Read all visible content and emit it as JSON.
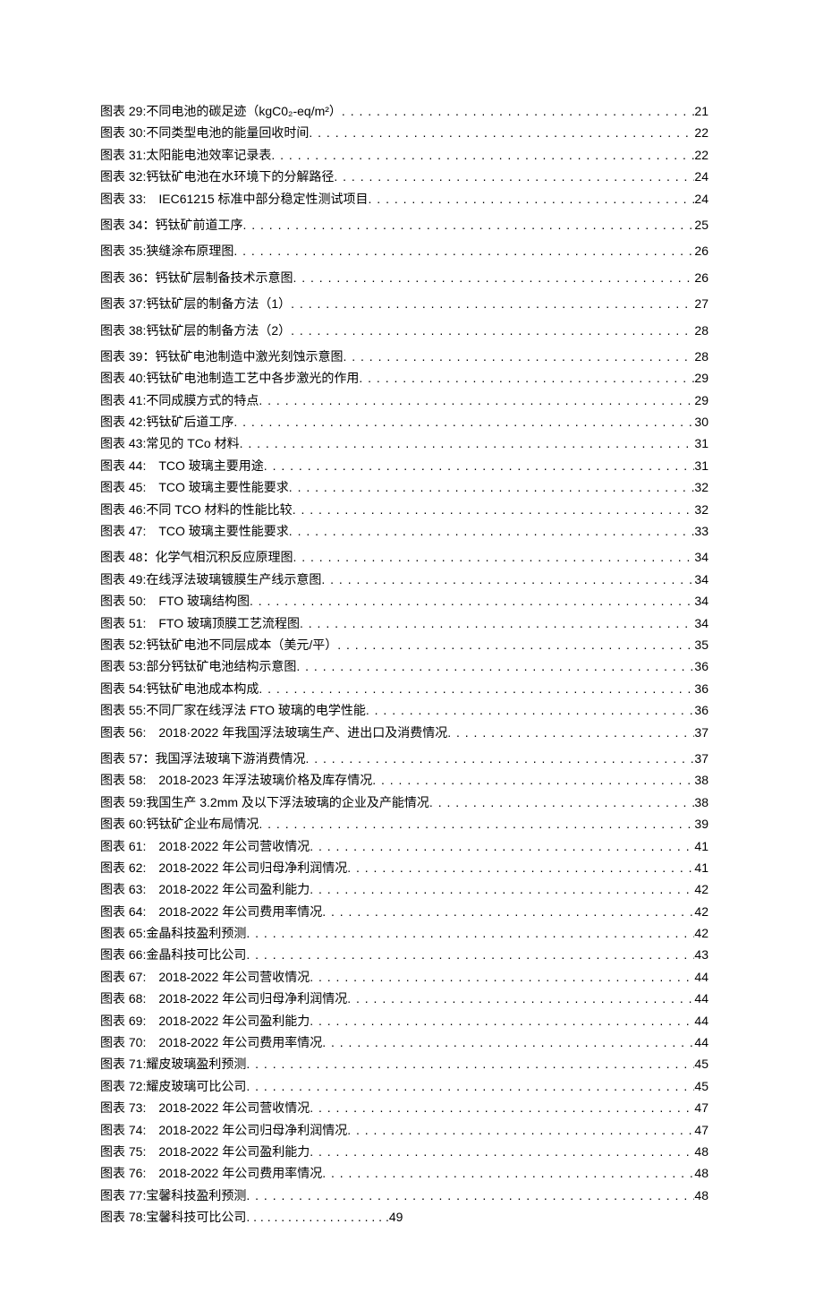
{
  "entries": [
    {
      "label": "图表 29:不同电池的碳足迹（kgC0₂-eq/m²）",
      "page": "21",
      "gap": false
    },
    {
      "label": "图表 30:不同类型电池的能量回收时间",
      "page": "22",
      "gap": false
    },
    {
      "label": "图表 31:太阳能电池效率记录表",
      "page": "22",
      "gap": false
    },
    {
      "label": "图表 32:钙钛矿电池在水环境下的分解路径",
      "page": "24",
      "gap": false
    },
    {
      "label": "图表 33:　IEC61215 标准中部分稳定性测试项目",
      "page": "24",
      "gap": true
    },
    {
      "label": "图表 34：钙钛矿前道工序",
      "page": "25",
      "gap": true
    },
    {
      "label": "图表 35:狭缝涂布原理图",
      "page": "26",
      "gap": true
    },
    {
      "label": "图表 36：钙钛矿层制备技术示意图",
      "page": "26",
      "gap": true
    },
    {
      "label": "图表 37:钙钛矿层的制备方法（1）",
      "page": "27",
      "gap": true
    },
    {
      "label": "图表 38:钙钛矿层的制备方法（2）",
      "page": "28",
      "gap": true
    },
    {
      "label": "图表 39：钙钛矿电池制造中激光刻蚀示意图",
      "page": "28",
      "gap": false
    },
    {
      "label": "图表 40:钙钛矿电池制造工艺中各步激光的作用",
      "page": "29",
      "gap": false
    },
    {
      "label": "图表 41:不同成膜方式的特点",
      "page": "29",
      "gap": false
    },
    {
      "label": "图表 42:钙钛矿后道工序",
      "page": "30",
      "gap": false
    },
    {
      "label": "图表 43:常见的 TCo 材料",
      "page": "31",
      "gap": false
    },
    {
      "label": "图表 44:　TCO 玻璃主要用途",
      "page": "31",
      "gap": false
    },
    {
      "label": "图表 45:　TCO 玻璃主要性能要求",
      "page": "32",
      "gap": false
    },
    {
      "label": "图表 46:不同 TCO 材料的性能比较",
      "page": "32",
      "gap": false
    },
    {
      "label": "图表 47:　TCO 玻璃主要性能要求",
      "page": "33",
      "gap": true
    },
    {
      "label": "图表 48：化学气相沉积反应原理图",
      "page": "34",
      "gap": false
    },
    {
      "label": "图表 49:在线浮法玻璃镀膜生产线示意图",
      "page": "34",
      "gap": false
    },
    {
      "label": "图表 50:　FTO 玻璃结构图",
      "page": "34",
      "gap": false
    },
    {
      "label": "图表 51:　FTO 玻璃顶膜工艺流程图",
      "page": "34",
      "gap": false
    },
    {
      "label": "图表 52:钙钛矿电池不同层成本（美元/平）",
      "page": "35",
      "gap": false
    },
    {
      "label": "图表 53:部分钙钛矿电池结构示意图",
      "page": "36",
      "gap": false
    },
    {
      "label": "图表 54:钙钛矿电池成本构成",
      "page": "36",
      "gap": false
    },
    {
      "label": "图表 55:不同厂家在线浮法 FTO 玻璃的电学性能",
      "page": "36",
      "gap": false
    },
    {
      "label": "图表 56:　2018·2022 年我国浮法玻璃生产、进出口及消费情况",
      "page": "37",
      "gap": true
    },
    {
      "label": "图表 57：我国浮法玻璃下游消费情况",
      "page": "37",
      "gap": false
    },
    {
      "label": "图表 58:　2018-2023 年浮法玻璃价格及库存情况",
      "page": "38",
      "gap": false
    },
    {
      "label": "图表 59:我国生产 3.2mm 及以下浮法玻璃的企业及产能情况",
      "page": "38",
      "gap": false
    },
    {
      "label": "图表 60:钙钛矿企业布局情况",
      "page": "39",
      "gap": false
    },
    {
      "label": "图表 61:　2018·2022 年公司营收情况",
      "page": "41",
      "gap": false
    },
    {
      "label": "图表 62:　2018-2022 年公司归母净利润情况",
      "page": "41",
      "gap": false
    },
    {
      "label": "图表 63:　2018-2022 年公司盈利能力",
      "page": "42",
      "gap": false
    },
    {
      "label": "图表 64:　2018-2022 年公司费用率情况",
      "page": "42",
      "gap": false
    },
    {
      "label": "图表 65:金晶科技盈利预测",
      "page": "42",
      "gap": false
    },
    {
      "label": "图表 66:金晶科技可比公司",
      "page": "43",
      "gap": false
    },
    {
      "label": "图表 67:　2018-2022 年公司营收情况",
      "page": "44",
      "gap": false
    },
    {
      "label": "图表 68:　2018-2022 年公司归母净利润情况",
      "page": "44",
      "gap": false
    },
    {
      "label": "图表 69:　2018-2022 年公司盈利能力",
      "page": "44",
      "gap": false
    },
    {
      "label": "图表 70:　2018-2022 年公司费用率情况",
      "page": "44",
      "gap": false
    },
    {
      "label": "图表 71:耀皮玻璃盈利预测",
      "page": "45",
      "gap": false
    },
    {
      "label": "图表 72:耀皮玻璃可比公司",
      "page": "45",
      "gap": false
    },
    {
      "label": "图表 73:　2018-2022 年公司营收情况",
      "page": "47",
      "gap": false
    },
    {
      "label": "图表 74:　2018-2022 年公司归母净利润情况",
      "page": "47",
      "gap": false
    },
    {
      "label": "图表 75:　2018-2022 年公司盈利能力",
      "page": "48",
      "gap": false
    },
    {
      "label": "图表 76:　2018-2022 年公司费用率情况",
      "page": "48",
      "gap": false
    },
    {
      "label": "图表 77:宝馨科技盈利预测",
      "page": "48",
      "gap": false
    },
    {
      "label": "图表 78:宝馨科技可比公司",
      "page": "49",
      "gap": false,
      "shortDots": true
    }
  ]
}
